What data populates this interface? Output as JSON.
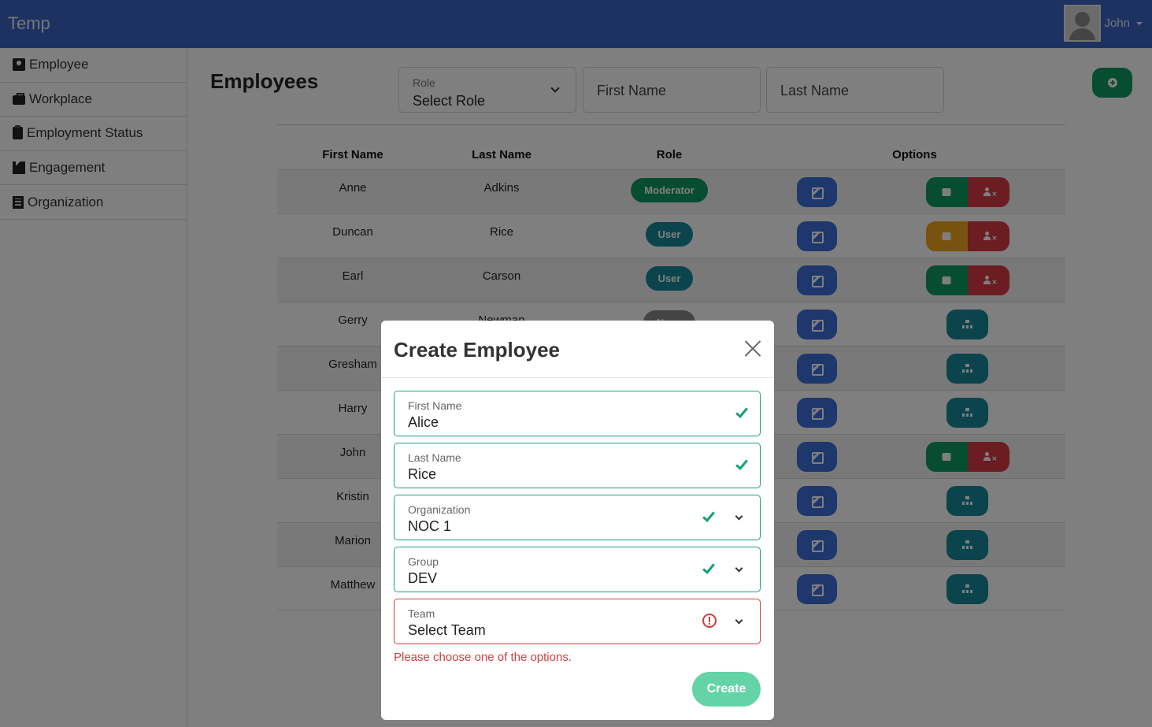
{
  "app": {
    "brand": "Temp",
    "user_name": "John"
  },
  "sidebar": {
    "items": [
      {
        "label": "Employee",
        "icon": "id-card-icon"
      },
      {
        "label": "Workplace",
        "icon": "briefcase-icon"
      },
      {
        "label": "Employment Status",
        "icon": "clipboard-icon"
      },
      {
        "label": "Engagement",
        "icon": "industry-icon"
      },
      {
        "label": "Organization",
        "icon": "building-icon"
      }
    ]
  },
  "main": {
    "title": "Employees",
    "filters": {
      "role_label": "Role",
      "role_value": "Select Role",
      "first_name_placeholder": "First Name",
      "last_name_placeholder": "Last Name"
    },
    "table": {
      "headers": [
        "First Name",
        "Last Name",
        "Role",
        "Options"
      ],
      "rows": [
        {
          "first": "Anne",
          "last": "Adkins",
          "role": "Moderator",
          "options": "lock-delete"
        },
        {
          "first": "Duncan",
          "last": "Rice",
          "role": "User",
          "options": "locked-delete"
        },
        {
          "first": "Earl",
          "last": "Carson",
          "role": "User",
          "options": "lock-delete"
        },
        {
          "first": "Gerry",
          "last": "Newman",
          "role": "None",
          "options": "org"
        },
        {
          "first": "Gresham",
          "last": "",
          "role": "",
          "options": "org"
        },
        {
          "first": "Harry",
          "last": "",
          "role": "",
          "options": "org"
        },
        {
          "first": "John",
          "last": "",
          "role": "",
          "options": "lock-delete"
        },
        {
          "first": "Kristin",
          "last": "",
          "role": "",
          "options": "org"
        },
        {
          "first": "Marion",
          "last": "",
          "role": "",
          "options": "org"
        },
        {
          "first": "Matthew",
          "last": "",
          "role": "",
          "options": "org"
        }
      ]
    }
  },
  "modal": {
    "title": "Create Employee",
    "fields": {
      "first_name": {
        "label": "First Name",
        "value": "Alice",
        "state": "valid"
      },
      "last_name": {
        "label": "Last Name",
        "value": "Rice",
        "state": "valid"
      },
      "organization": {
        "label": "Organization",
        "value": "NOC 1",
        "state": "valid"
      },
      "group": {
        "label": "Group",
        "value": "DEV",
        "state": "valid"
      },
      "team": {
        "label": "Team",
        "value": "Select Team",
        "state": "invalid"
      }
    },
    "error": "Please choose one of the options.",
    "create_label": "Create"
  },
  "colors": {
    "navbar": "#3d64c4",
    "success": "#0e9a62",
    "danger": "#d63a45",
    "warning": "#f2a41e",
    "info": "#17899a",
    "primary": "#3d6fd8"
  }
}
